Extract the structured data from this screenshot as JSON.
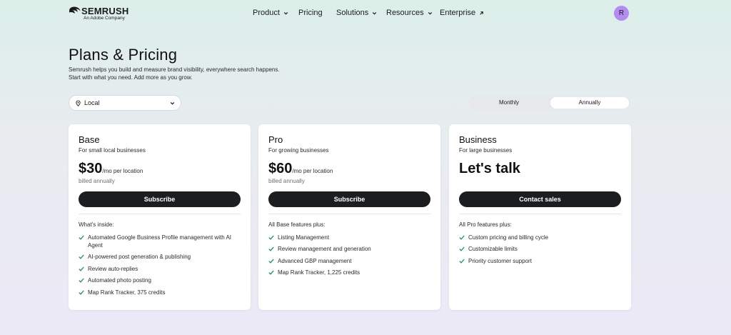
{
  "header": {
    "logo_text": "SEMRUSH",
    "logo_sub": "An Adobe Company",
    "nav": {
      "product": "Product",
      "pricing": "Pricing",
      "solutions": "Solutions",
      "resources": "Resources",
      "enterprise": "Enterprise"
    },
    "avatar_initial": "R"
  },
  "page": {
    "title": "Plans & Pricing",
    "subtitle_line1": "Semrush helps you build and measure brand visibility, everywhere search happens.",
    "subtitle_line2": "Start with what you need. Add more as you grow."
  },
  "filters": {
    "location_value": "Local",
    "billing_options": [
      "Monthly",
      "Annually"
    ],
    "billing_selected": "Annually"
  },
  "plans": [
    {
      "name": "Base",
      "for": "For small local businesses",
      "price": "$30",
      "per": "/mo per location",
      "billed": "billed annually",
      "cta": "Subscribe",
      "features_heading": "What's inside:",
      "features": [
        "Automated Google Business Profile management with AI Agent",
        "AI-powered post generation & publishing",
        "Review auto-replies",
        "Automated photo posting",
        "Map Rank Tracker, 375 credits"
      ]
    },
    {
      "name": "Pro",
      "for": "For growing businesses",
      "price": "$60",
      "per": "/mo per location",
      "billed": "billed annually",
      "cta": "Subscribe",
      "features_heading": "All Base features plus:",
      "features": [
        "Listing Management",
        "Review management and generation",
        "Advanced GBP management",
        "Map Rank Tracker, 1,225 credits"
      ]
    },
    {
      "name": "Business",
      "for": "For large businesses",
      "price_text": "Let's talk",
      "cta": "Contact sales",
      "features_heading": "All Pro features plus:",
      "features": [
        "Custom pricing and billing cycle",
        "Customizable limits",
        "Priority customer support"
      ]
    }
  ],
  "colors": {
    "cta_bg": "#1c1d1f",
    "check": "#1a8f6e",
    "avatar": "#b48bf0"
  }
}
